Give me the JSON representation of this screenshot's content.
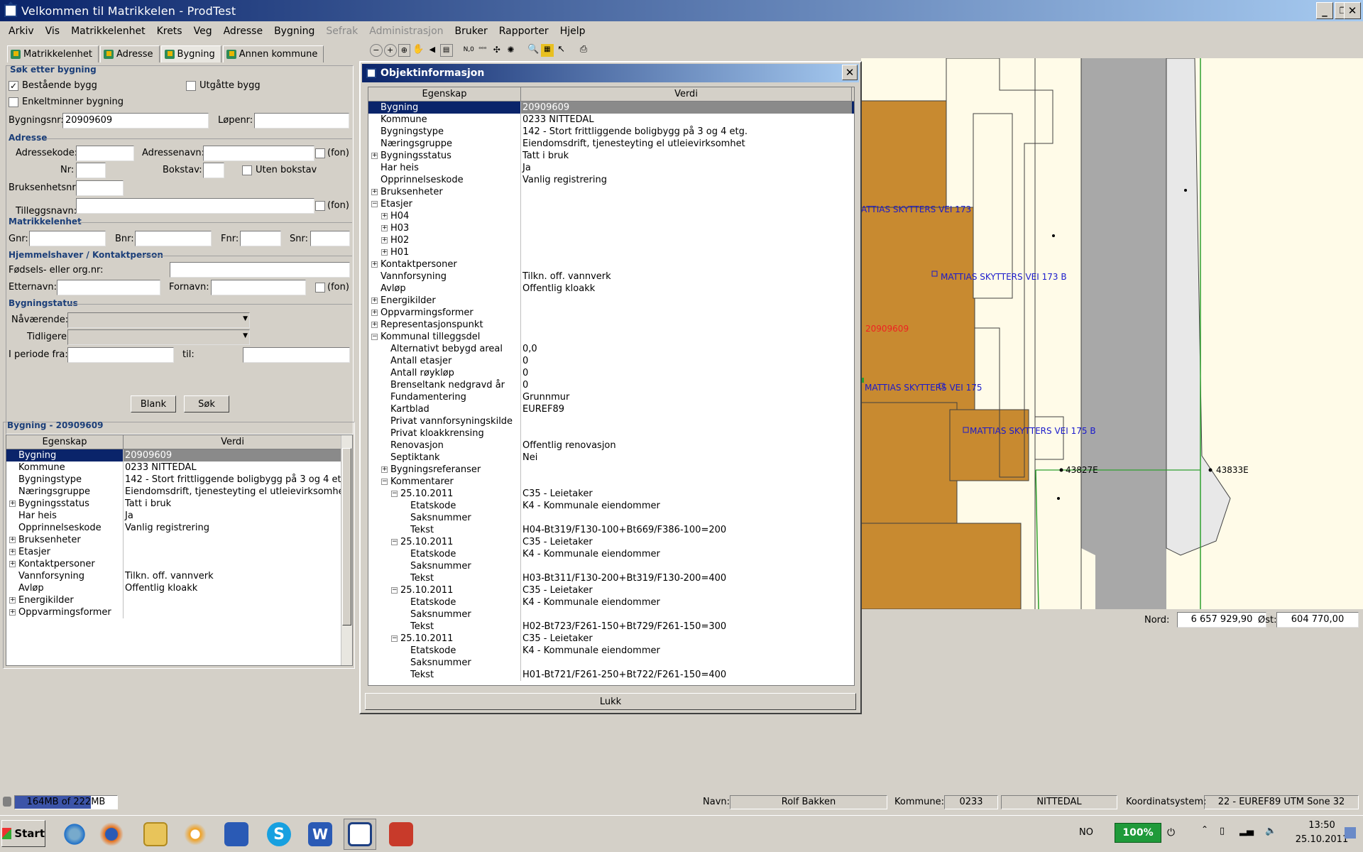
{
  "window": {
    "title": "Velkommen til Matrikkelen - ProdTest"
  },
  "menu": [
    "Arkiv",
    "Vis",
    "Matrikkelenhet",
    "Krets",
    "Veg",
    "Adresse",
    "Bygning",
    "Sefrak",
    "Administrasjon",
    "Bruker",
    "Rapporter",
    "Hjelp"
  ],
  "tabs": [
    "Matrikkelenhet",
    "Adresse",
    "Bygning",
    "Annen kommune"
  ],
  "search": {
    "group": "Søk etter bygning",
    "bestaende": "Bestående bygg",
    "utgatte": "Utgåtte bygg",
    "enkeltminner": "Enkeltminner bygning",
    "bygningsnr_label": "Bygningsnr:",
    "bygningsnr_value": "20909609",
    "lopenr_label": "Løpenr:",
    "adresse_group": "Adresse",
    "adressekode": "Adressekode:",
    "adressenavn": "Adressenavn:",
    "fon": "(fon)",
    "nr": "Nr:",
    "bokstav": "Bokstav:",
    "uten_bokstav": "Uten bokstav",
    "bruksenhetsnr": "Bruksenhetsnr:",
    "tilleggsnavn": "Tilleggsnavn:",
    "matrikkelenhet_group": "Matrikkelenhet",
    "gnr": "Gnr:",
    "bnr": "Bnr:",
    "fnr": "Fnr:",
    "snr": "Snr:",
    "hjemmel_group": "Hjemmelshaver / Kontaktperson",
    "fodsels": "Fødsels- eller org.nr:",
    "etternavn": "Etternavn:",
    "fornavn": "Fornavn:",
    "status_group": "Bygningstatus",
    "navarende": "Nåværende:",
    "tidligere": "Tidligere:",
    "periode_fra": "I periode fra:",
    "til": "til:",
    "blank_btn": "Blank",
    "sok_btn": "Søk"
  },
  "result": {
    "group": "Bygning - 20909609",
    "col_key": "Egenskap",
    "col_val": "Verdi",
    "rows": [
      {
        "k": "Bygning",
        "v": "20909609",
        "e": ""
      },
      {
        "k": "Kommune",
        "v": "0233  NITTEDAL",
        "e": ""
      },
      {
        "k": "Bygningstype",
        "v": "142 - Stort frittliggende boligbygg på 3 og 4 etg.",
        "e": ""
      },
      {
        "k": "Næringsgruppe",
        "v": "Eiendomsdrift, tjenesteyting el utleievirksomhet",
        "e": ""
      },
      {
        "k": "Bygningsstatus",
        "v": "Tatt i bruk",
        "e": "+"
      },
      {
        "k": "Har heis",
        "v": "Ja",
        "e": ""
      },
      {
        "k": "Opprinnelseskode",
        "v": "Vanlig registrering",
        "e": ""
      },
      {
        "k": "Bruksenheter",
        "v": "",
        "e": "+"
      },
      {
        "k": "Etasjer",
        "v": "",
        "e": "+"
      },
      {
        "k": "Kontaktpersoner",
        "v": "",
        "e": "+"
      },
      {
        "k": "Vannforsyning",
        "v": "Tilkn. off. vannverk",
        "e": ""
      },
      {
        "k": "Avløp",
        "v": "Offentlig kloakk",
        "e": ""
      },
      {
        "k": "Energikilder",
        "v": "",
        "e": "+"
      },
      {
        "k": "Oppvarmingsformer",
        "v": "",
        "e": "+"
      }
    ]
  },
  "dialog": {
    "title": "Objektinformasjon",
    "col_key": "Egenskap",
    "col_val": "Verdi",
    "close_btn": "Lukk",
    "rows": [
      {
        "k": "Bygning",
        "v": "20909609",
        "e": "",
        "d": 0
      },
      {
        "k": "Kommune",
        "v": "0233  NITTEDAL",
        "e": "",
        "d": 0
      },
      {
        "k": "Bygningstype",
        "v": "142 - Stort frittliggende boligbygg på 3 og 4 etg.",
        "e": "",
        "d": 0
      },
      {
        "k": "Næringsgruppe",
        "v": "Eiendomsdrift, tjenesteyting el utleievirksomhet",
        "e": "",
        "d": 0
      },
      {
        "k": "Bygningsstatus",
        "v": "Tatt i bruk",
        "e": "+",
        "d": 0
      },
      {
        "k": "Har heis",
        "v": "Ja",
        "e": "",
        "d": 0
      },
      {
        "k": "Opprinnelseskode",
        "v": "Vanlig registrering",
        "e": "",
        "d": 0
      },
      {
        "k": "Bruksenheter",
        "v": "",
        "e": "+",
        "d": 0
      },
      {
        "k": "Etasjer",
        "v": "",
        "e": "-",
        "d": 0
      },
      {
        "k": "H04",
        "v": "",
        "e": "+",
        "d": 1
      },
      {
        "k": "H03",
        "v": "",
        "e": "+",
        "d": 1
      },
      {
        "k": "H02",
        "v": "",
        "e": "+",
        "d": 1
      },
      {
        "k": "H01",
        "v": "",
        "e": "+",
        "d": 1
      },
      {
        "k": "Kontaktpersoner",
        "v": "",
        "e": "+",
        "d": 0
      },
      {
        "k": "Vannforsyning",
        "v": "Tilkn. off. vannverk",
        "e": "",
        "d": 0
      },
      {
        "k": "Avløp",
        "v": "Offentlig kloakk",
        "e": "",
        "d": 0
      },
      {
        "k": "Energikilder",
        "v": "",
        "e": "+",
        "d": 0
      },
      {
        "k": "Oppvarmingsformer",
        "v": "",
        "e": "+",
        "d": 0
      },
      {
        "k": "Representasjonspunkt",
        "v": "",
        "e": "+",
        "d": 0
      },
      {
        "k": "Kommunal tilleggsdel",
        "v": "",
        "e": "-",
        "d": 0
      },
      {
        "k": "Alternativt bebygd areal",
        "v": "0,0",
        "e": "",
        "d": 1
      },
      {
        "k": "Antall etasjer",
        "v": "0",
        "e": "",
        "d": 1
      },
      {
        "k": "Antall røykløp",
        "v": "0",
        "e": "",
        "d": 1
      },
      {
        "k": "Brenseltank nedgravd år",
        "v": "0",
        "e": "",
        "d": 1
      },
      {
        "k": "Fundamentering",
        "v": "Grunnmur",
        "e": "",
        "d": 1
      },
      {
        "k": "Kartblad",
        "v": "EUREF89",
        "e": "",
        "d": 1
      },
      {
        "k": "Privat vannforsyningskilde",
        "v": "",
        "e": "",
        "d": 1
      },
      {
        "k": "Privat kloakkrensing",
        "v": "",
        "e": "",
        "d": 1
      },
      {
        "k": "Renovasjon",
        "v": "Offentlig renovasjon",
        "e": "",
        "d": 1
      },
      {
        "k": "Septiktank",
        "v": "Nei",
        "e": "",
        "d": 1
      },
      {
        "k": "Bygningsreferanser",
        "v": "",
        "e": "+",
        "d": 1
      },
      {
        "k": "Kommentarer",
        "v": "",
        "e": "-",
        "d": 1
      },
      {
        "k": "25.10.2011",
        "v": "C35 - Leietaker",
        "e": "-",
        "d": 2
      },
      {
        "k": "Etatskode",
        "v": "K4 - Kommunale eiendommer",
        "e": "",
        "d": 3
      },
      {
        "k": "Saksnummer",
        "v": "",
        "e": "",
        "d": 3
      },
      {
        "k": "Tekst",
        "v": "H04-Bt319/F130-100+Bt669/F386-100=200",
        "e": "",
        "d": 3
      },
      {
        "k": "25.10.2011",
        "v": "C35 - Leietaker",
        "e": "-",
        "d": 2
      },
      {
        "k": "Etatskode",
        "v": "K4 - Kommunale eiendommer",
        "e": "",
        "d": 3
      },
      {
        "k": "Saksnummer",
        "v": "",
        "e": "",
        "d": 3
      },
      {
        "k": "Tekst",
        "v": "H03-Bt311/F130-200+Bt319/F130-200=400",
        "e": "",
        "d": 3
      },
      {
        "k": "25.10.2011",
        "v": "C35 - Leietaker",
        "e": "-",
        "d": 2
      },
      {
        "k": "Etatskode",
        "v": "K4 - Kommunale eiendommer",
        "e": "",
        "d": 3
      },
      {
        "k": "Saksnummer",
        "v": "",
        "e": "",
        "d": 3
      },
      {
        "k": "Tekst",
        "v": "H02-Bt723/F261-150+Bt729/F261-150=300",
        "e": "",
        "d": 3
      },
      {
        "k": "25.10.2011",
        "v": "C35 - Leietaker",
        "e": "-",
        "d": 2
      },
      {
        "k": "Etatskode",
        "v": "K4 - Kommunale eiendommer",
        "e": "",
        "d": 3
      },
      {
        "k": "Saksnummer",
        "v": "",
        "e": "",
        "d": 3
      },
      {
        "k": "Tekst",
        "v": "H01-Bt721/F261-250+Bt722/F261-150=400",
        "e": "",
        "d": 3
      }
    ]
  },
  "map": {
    "labels": [
      "ATTIAS SKYTTERS VEI 173",
      "MATTIAS SKYTTERS VEI 173 B",
      "20909609",
      "MATTIAS SKYTTERS VEI 175",
      "MATTIAS SKYTTERS VEI 175 B",
      "43827E",
      "43833E"
    ],
    "nord_label": "Nord:",
    "nord_value": "6 657 929,90",
    "ost_label": "Øst:",
    "ost_value": "604 770,00"
  },
  "status": {
    "memory": "164MB of 222MB",
    "memory_fraction": 0.74,
    "navn_label": "Navn:",
    "navn_value": "Rolf Bakken",
    "kommune_label": "Kommune:",
    "kommune_code": "0233",
    "kommune_name": "NITTEDAL",
    "koord_label": "Koordinatsystem:",
    "koord_value": "22 - EUREF89 UTM Sone 32"
  },
  "taskbar": {
    "start": "Start",
    "lang": "NO",
    "battery": "100%",
    "time": "13:50",
    "date": "25.10.2011"
  },
  "colors": {
    "building": "#c88a30",
    "road": "#a8a8a8",
    "accent": "#0a246a",
    "map_label": "#1a1acc",
    "selected_label": "#ee2222"
  }
}
